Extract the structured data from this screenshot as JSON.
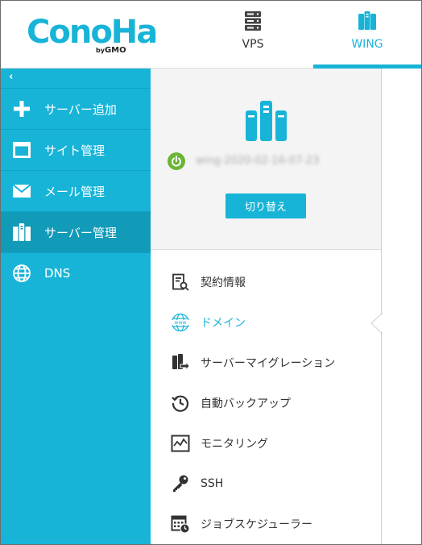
{
  "brand": {
    "logo_text": "ConoHa",
    "logo_sub_by": "by",
    "logo_sub_gmo": "GMO"
  },
  "tabs": [
    {
      "label": "VPS",
      "icon": "vps-server-icon"
    },
    {
      "label": "WING",
      "icon": "wing-server-icon",
      "active": true
    }
  ],
  "sidebar": {
    "collapse_glyph": "‹",
    "items": [
      {
        "label": "サーバー追加",
        "icon": "plus-icon"
      },
      {
        "label": "サイト管理",
        "icon": "window-icon"
      },
      {
        "label": "メール管理",
        "icon": "mail-icon"
      },
      {
        "label": "サーバー管理",
        "icon": "server-icon",
        "active": true
      },
      {
        "label": "DNS",
        "icon": "globe-icon"
      }
    ]
  },
  "server_panel": {
    "status": "running",
    "server_name": "wing-2020-02-16-07-23",
    "switch_label": "切り替え"
  },
  "menu": {
    "items": [
      {
        "label": "契約情報",
        "icon": "contract-search-icon"
      },
      {
        "label": "ドメイン",
        "icon": "www-globe-icon",
        "selected": true
      },
      {
        "label": "サーバーマイグレーション",
        "icon": "server-migration-icon"
      },
      {
        "label": "自動バックアップ",
        "icon": "backup-clock-icon"
      },
      {
        "label": "モニタリング",
        "icon": "monitoring-chart-icon"
      },
      {
        "label": "SSH",
        "icon": "key-icon"
      },
      {
        "label": "ジョブスケジューラー",
        "icon": "scheduler-calendar-icon"
      }
    ]
  },
  "colors": {
    "accent": "#18b4d8",
    "sidebar_active": "#129ab9",
    "power_on": "#6ab536"
  }
}
